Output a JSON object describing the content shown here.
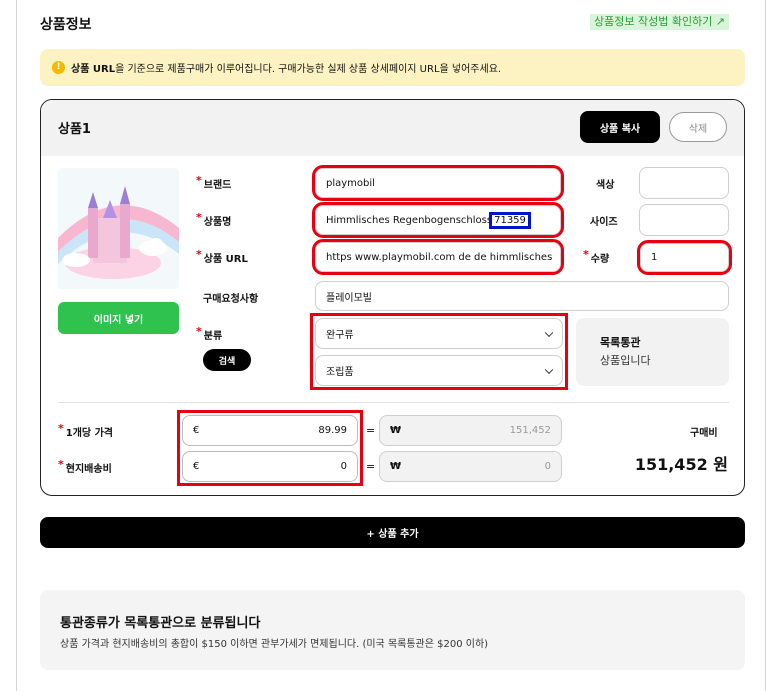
{
  "header": {
    "title": "상품정보",
    "guide_link": "상품정보 작성법 확인하기 ↗"
  },
  "notice": {
    "bold": "상품 URL",
    "text": "을 기준으로 제품구매가 이루어집니다. 구매가능한 실제 상품 상세페이지 URL을 넣어주세요."
  },
  "product": {
    "title": "상품1",
    "copy_button": "상품 복사",
    "delete_button": "삭제",
    "image_button": "이미지 넣기",
    "brand": {
      "label": "브랜드",
      "value": "playmobil"
    },
    "name": {
      "label": "상품명",
      "value_prefix": "Himmlisches Regenbogenschloss ",
      "value_highlight": "71359"
    },
    "url": {
      "label": "상품 URL",
      "value": "https www.playmobil.com de de himmlisches"
    },
    "request": {
      "label": "구매요청사항",
      "value": "플레이모빌"
    },
    "color": {
      "label": "색상",
      "value": ""
    },
    "size": {
      "label": "사이즈",
      "value": ""
    },
    "quantity": {
      "label": "수량",
      "value": "1"
    },
    "category": {
      "label": "분류",
      "search_button": "검색",
      "main_value": "완구류",
      "sub_value": "조립품"
    },
    "customs_box": {
      "title": "목록통관",
      "sub": "상품입니다"
    },
    "unit_price": {
      "label": "1개당 가격",
      "currency": "€",
      "value": "89.99",
      "eq": "=",
      "krw_symbol": "₩",
      "krw_value": "151,452"
    },
    "shipping": {
      "label": "현지배송비",
      "currency": "€",
      "value": "0",
      "eq": "=",
      "krw_symbol": "₩",
      "krw_value": "0"
    },
    "purchase": {
      "label": "구매비",
      "total": "151,452 원"
    }
  },
  "add_product_button": "+ 상품 추가",
  "info_box": {
    "title": "통관종류가 목록통관으로 분류됩니다",
    "text": "상품 가격과 현지배송비의 총합이 $150 이하면 관부가세가 면제됩니다. (미국 목록통관은 $200 이하)"
  },
  "colors": {
    "accent_green": "#2fc24f",
    "notice_bg": "#fdf3c2",
    "highlight_red": "#e60012",
    "highlight_blue": "#0014cc"
  }
}
